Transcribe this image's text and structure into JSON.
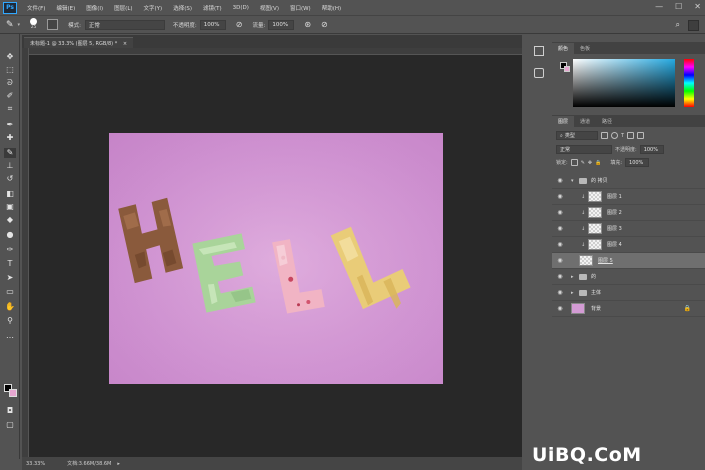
{
  "app": {
    "logo": "Ps",
    "menu": [
      "文件(F)",
      "编辑(E)",
      "图像(I)",
      "图层(L)",
      "文字(Y)",
      "选择(S)",
      "滤镜(T)",
      "3D(D)",
      "视图(V)",
      "窗口(W)",
      "帮助(H)"
    ],
    "window_controls": [
      "—",
      "☐",
      "✕"
    ]
  },
  "options_bar": {
    "brush_size": "25",
    "mode_label": "模式:",
    "mode_value": "正常",
    "opacity_label": "不透明度:",
    "opacity_value": "100%",
    "flow_label": "流量:",
    "flow_value": "100%"
  },
  "document": {
    "tab_title": "未标题-1 @ 33.3% (图层 5, RGB/8) *",
    "zoom": "33.33%",
    "doc_size": "文档:3.66M/38.6M",
    "background_color": "#d39bd4",
    "letters": [
      {
        "char": "H",
        "color": "#8a5a3c"
      },
      {
        "char": "E",
        "color": "#a9d49a"
      },
      {
        "char": "L",
        "color": "#f1b4c4"
      },
      {
        "char": "L",
        "color": "#e9cc78"
      }
    ]
  },
  "toolbar": {
    "foreground": "#000000",
    "background": "#e6a6d0"
  },
  "color_panel": {
    "tabs": [
      "颜色",
      "色板"
    ],
    "hue_color": "#25a9e1"
  },
  "layers_panel": {
    "tabs": [
      "图层",
      "通道",
      "路径"
    ],
    "filter_kind": "类型",
    "blend_mode": "正常",
    "opacity_label": "不透明度:",
    "opacity_value": "100%",
    "lock_label": "锁定:",
    "fill_label": "填充:",
    "fill_value": "100%",
    "layers": [
      {
        "name": "的 拷贝",
        "type": "group"
      },
      {
        "name": "图层 1",
        "type": "layer"
      },
      {
        "name": "图层 2",
        "type": "layer"
      },
      {
        "name": "图层 3",
        "type": "layer"
      },
      {
        "name": "图层 4",
        "type": "layer"
      },
      {
        "name": "图层 5",
        "type": "layer",
        "selected": true
      },
      {
        "name": "的",
        "type": "group"
      },
      {
        "name": "主体",
        "type": "group"
      },
      {
        "name": "背景",
        "type": "background"
      }
    ]
  },
  "watermark": "UiBQ.CoM"
}
